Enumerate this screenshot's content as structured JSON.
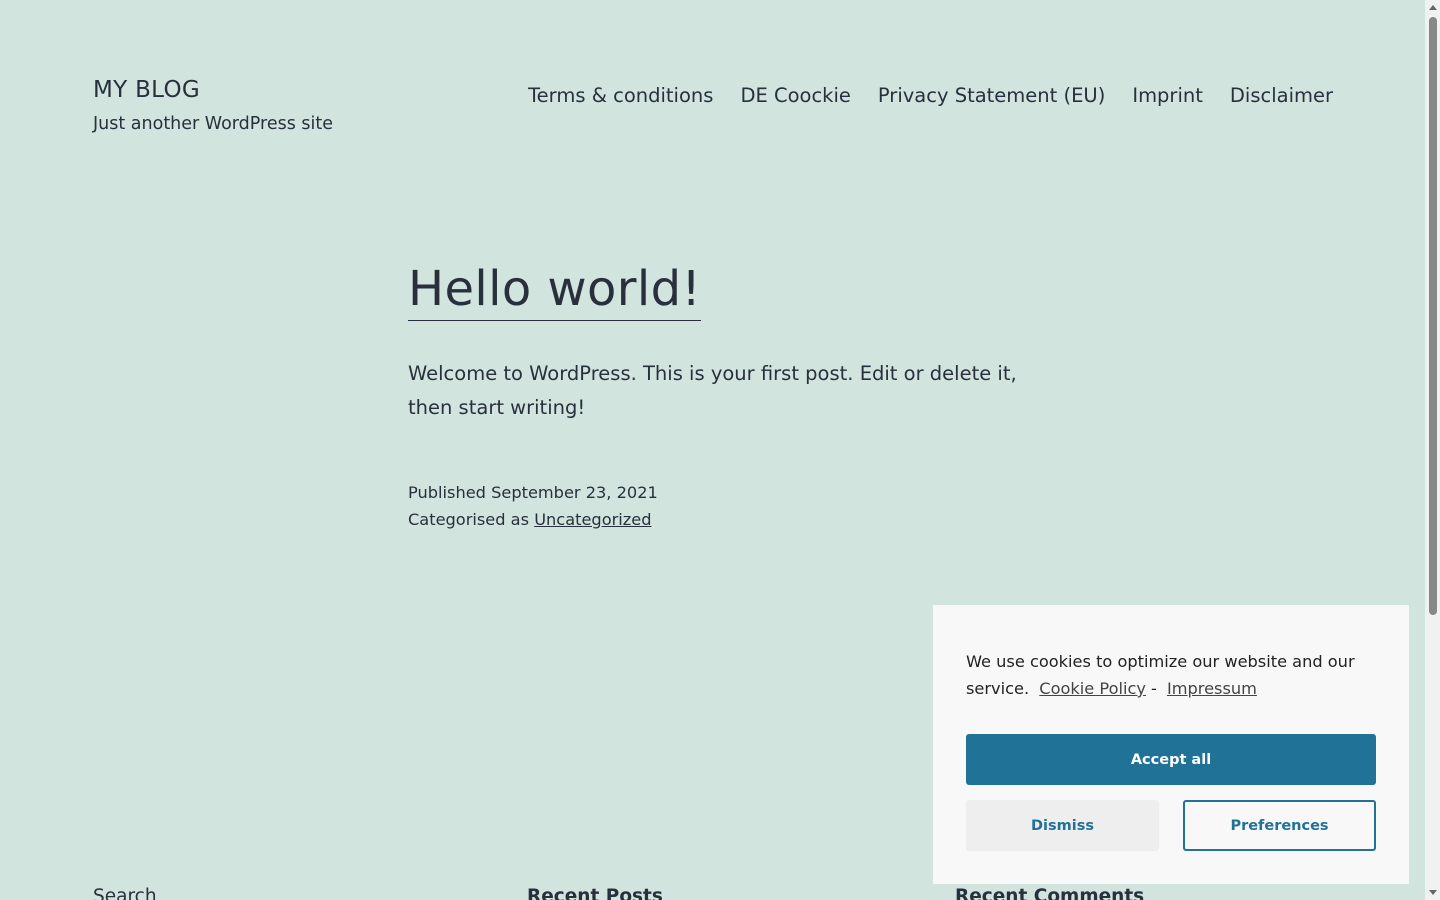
{
  "header": {
    "site_title": "MY BLOG",
    "tagline": "Just another WordPress site",
    "nav": [
      {
        "label": "Terms & conditions"
      },
      {
        "label": "DE Coockie"
      },
      {
        "label": "Privacy Statement (EU)"
      },
      {
        "label": "Imprint"
      },
      {
        "label": "Disclaimer"
      }
    ]
  },
  "post": {
    "title": "Hello world!",
    "content": "Welcome to WordPress. This is your first post. Edit or delete it, then start writing!",
    "published_label": "Published",
    "published_date": "September 23, 2021",
    "category_label": "Categorised as",
    "category": "Uncategorized"
  },
  "footer": {
    "widgets": [
      {
        "title": "Search"
      },
      {
        "title": "Recent Posts"
      },
      {
        "title": "Recent Comments"
      }
    ]
  },
  "cookie_banner": {
    "message": "We use cookies to optimize our website and our service.",
    "cookie_policy_link": "Cookie Policy",
    "separator": "-",
    "impressum_link": "Impressum",
    "accept_label": "Accept all",
    "dismiss_label": "Dismiss",
    "preferences_label": "Preferences"
  },
  "colors": {
    "background": "#d1e4dd",
    "text": "#28303d",
    "banner_bg": "#f8f8f8",
    "accent": "#217297"
  }
}
